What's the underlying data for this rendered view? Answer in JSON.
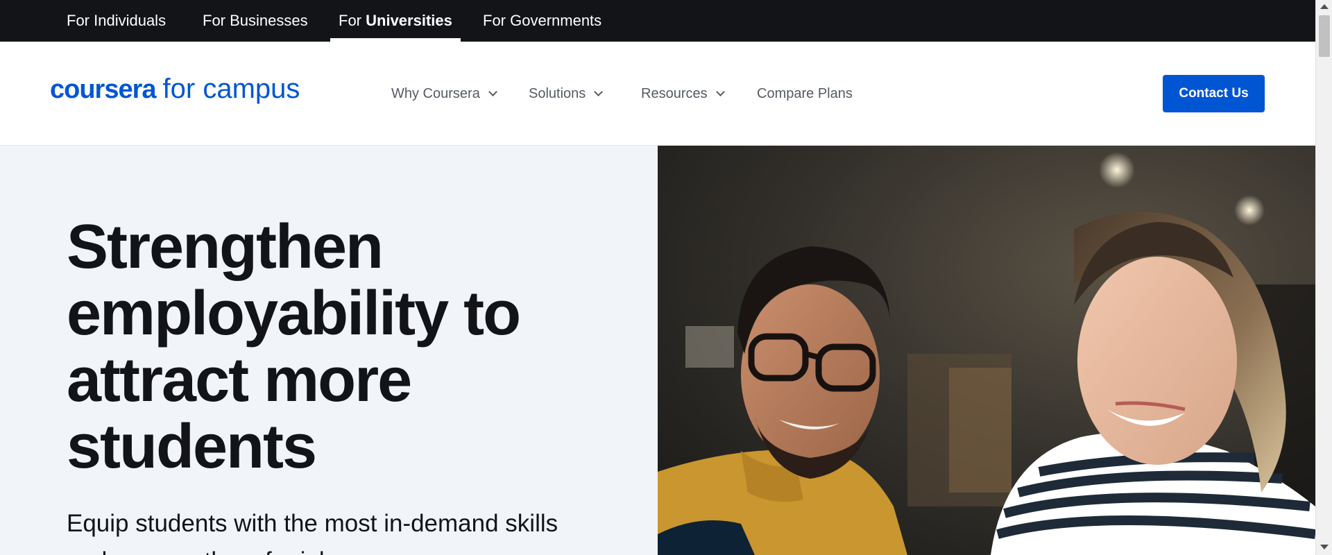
{
  "topbar": {
    "tabs": [
      {
        "label": "For Individuals"
      },
      {
        "prefix": "For ",
        "strong": "Universities",
        "label_prefix_only": true
      },
      {
        "label": "For Businesses"
      },
      {
        "label": "For Governments"
      }
    ],
    "individuals": "For Individuals",
    "businesses": "For Businesses",
    "universities_prefix": "For",
    "universities_strong": "Universities",
    "governments": "For Governments",
    "active_tab": "For Universities"
  },
  "logo": {
    "brand": "coursera",
    "suffix": "for campus"
  },
  "nav": {
    "why": "Why Coursera",
    "solutions": "Solutions",
    "resources": "Resources",
    "compare": "Compare Plans"
  },
  "header": {
    "contact_label": "Contact Us"
  },
  "hero": {
    "title": "Strengthen employability to attract more students",
    "subtitle": "Equip students with the most in-demand skills and prepare them for job",
    "image": "hero-photo-students-smiling-at-laptop"
  },
  "colors": {
    "brand_blue": "#0056d2",
    "topbar_bg": "#131417",
    "hero_bg": "#f1f4f9"
  }
}
